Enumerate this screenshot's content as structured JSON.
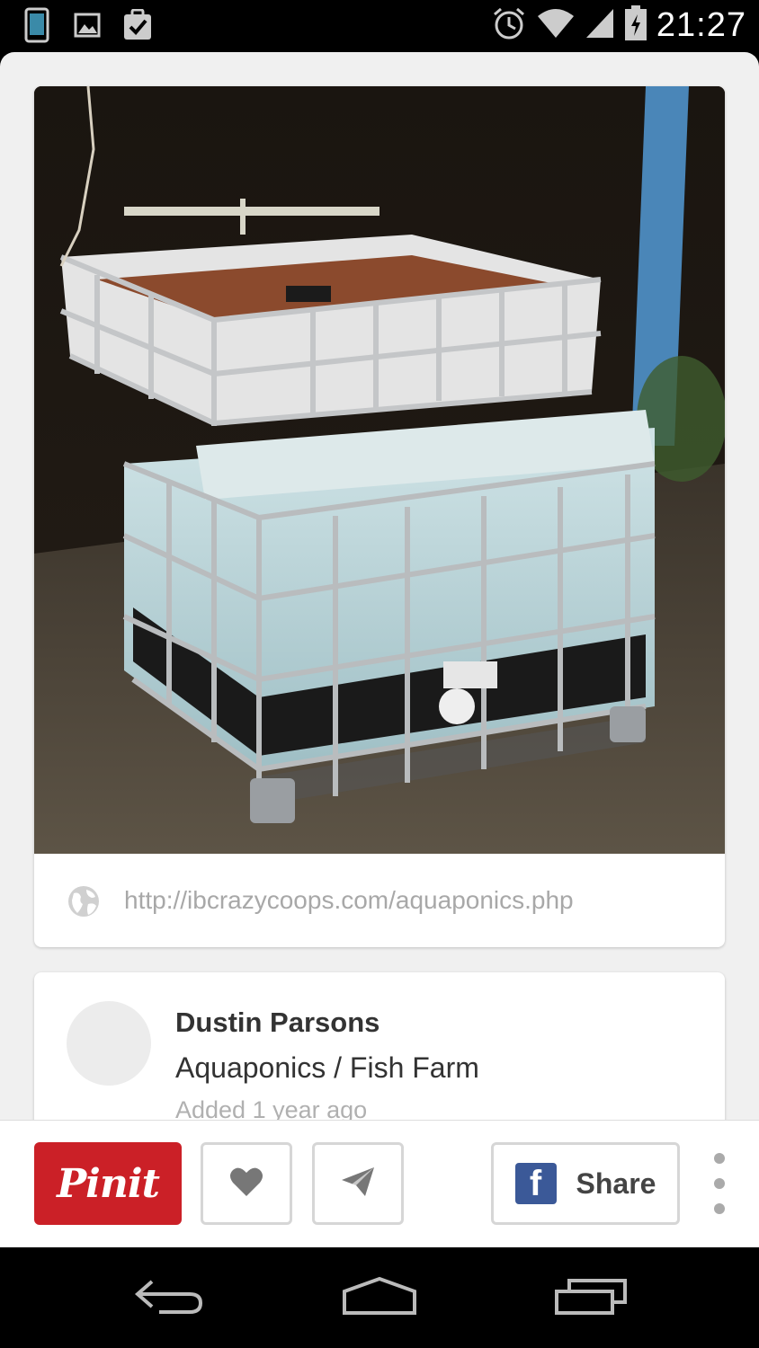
{
  "status_bar": {
    "time": "21:27",
    "left_icons": [
      "phone-icon",
      "image-icon",
      "task-icon"
    ],
    "right_icons": [
      "alarm-icon",
      "wifi-icon",
      "signal-icon",
      "battery-icon"
    ]
  },
  "pin": {
    "image_alt": "IBC tote aquaponics system with grow bed on top of fish tank",
    "source_url": "http://ibcrazycoops.com/aquaponics.php"
  },
  "pinner": {
    "name": "Dustin Parsons",
    "board": "Aquaponics / Fish Farm",
    "added": "Added 1 year ago"
  },
  "actions": {
    "pinit_label": "Pinit",
    "share_label": "Share",
    "fb_letter": "f"
  },
  "colors": {
    "pinterest_red": "#cb2027",
    "facebook_blue": "#3b5998"
  }
}
